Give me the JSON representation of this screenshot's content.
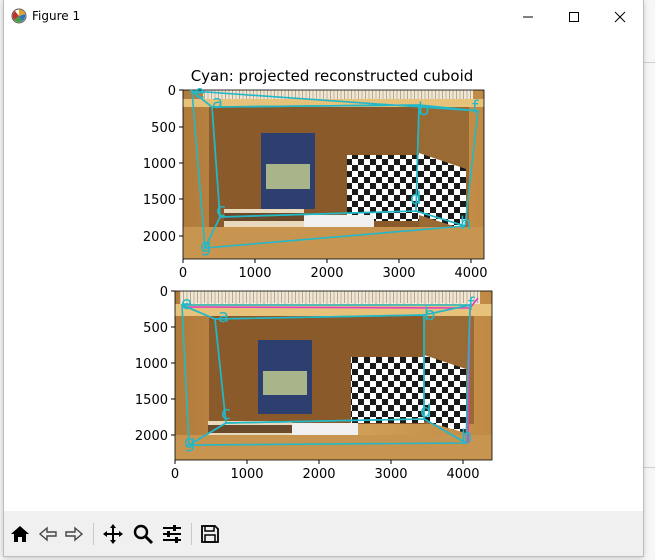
{
  "window": {
    "title": "Figure 1"
  },
  "figure": {
    "title": "Cyan: projected reconstructed cuboid",
    "top_axes": {
      "y_ticks": [
        "0",
        "500",
        "1000",
        "1500",
        "2000"
      ],
      "x_ticks": [
        "0",
        "1000",
        "2000",
        "3000",
        "4000"
      ]
    },
    "bottom_axes": {
      "y_ticks": [
        "0",
        "500",
        "1000",
        "1500",
        "2000"
      ],
      "x_ticks": [
        "0",
        "1000",
        "2000",
        "3000",
        "4000"
      ]
    },
    "cuboid_labels": [
      "e",
      "a",
      "b",
      "f",
      "c",
      "d",
      "h",
      "g"
    ],
    "colors": {
      "cuboid": "#22b8c8",
      "reference": "#e040c0"
    }
  },
  "toolbar": {
    "buttons": [
      "home-icon",
      "back-icon",
      "forward-icon",
      "pan-icon",
      "zoom-icon",
      "subplots-icon",
      "save-icon"
    ]
  }
}
